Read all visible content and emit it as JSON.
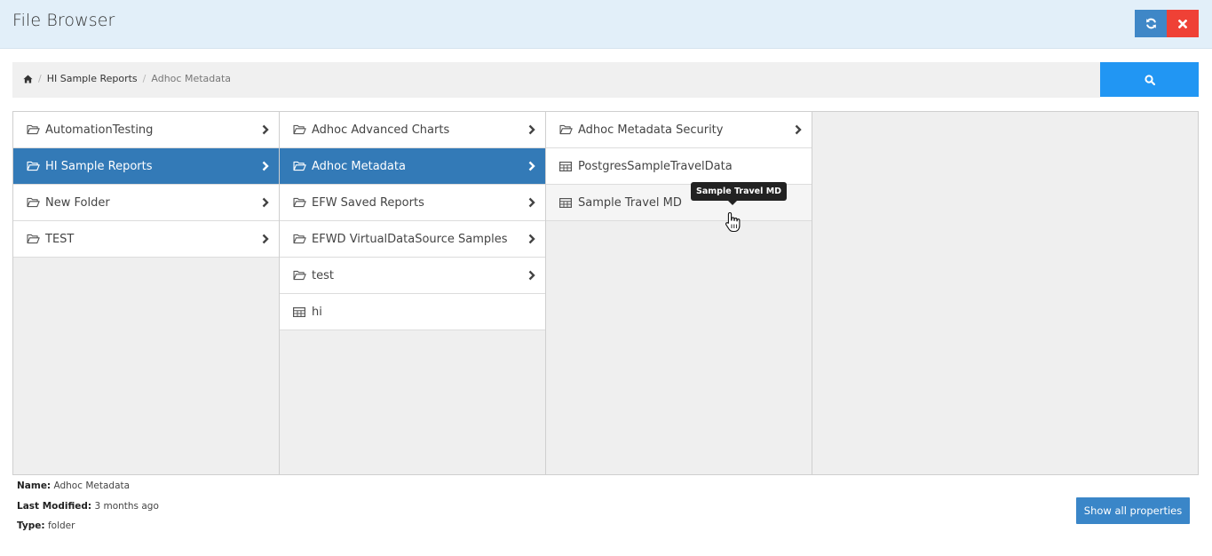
{
  "header": {
    "title": "File Browser",
    "refresh_icon": "refresh-icon",
    "close_icon": "close-icon"
  },
  "breadcrumb": {
    "home_icon": "home-icon",
    "items": [
      "HI Sample Reports",
      "Adhoc Metadata"
    ]
  },
  "search": {
    "icon": "search-icon"
  },
  "columns": [
    {
      "items": [
        {
          "label": "AutomationTesting",
          "type": "folder",
          "has_children": true
        },
        {
          "label": "HI Sample Reports",
          "type": "folder",
          "has_children": true,
          "selected": true
        },
        {
          "label": "New Folder",
          "type": "folder",
          "has_children": true
        },
        {
          "label": "TEST",
          "type": "folder",
          "has_children": true
        }
      ]
    },
    {
      "items": [
        {
          "label": "Adhoc Advanced Charts",
          "type": "folder",
          "has_children": true
        },
        {
          "label": "Adhoc Metadata",
          "type": "folder",
          "has_children": true,
          "selected": true
        },
        {
          "label": "EFW Saved Reports",
          "type": "folder",
          "has_children": true
        },
        {
          "label": "EFWD VirtualDataSource Samples",
          "type": "folder",
          "has_children": true
        },
        {
          "label": "test",
          "type": "folder",
          "has_children": true
        },
        {
          "label": "hi",
          "type": "table",
          "has_children": false
        }
      ]
    },
    {
      "items": [
        {
          "label": "Adhoc Metadata Security",
          "type": "folder",
          "has_children": true
        },
        {
          "label": "PostgresSampleTravelData",
          "type": "table",
          "has_children": false
        },
        {
          "label": "Sample Travel MD",
          "type": "table",
          "has_children": false,
          "hover": true
        }
      ]
    }
  ],
  "tooltip": {
    "text": "Sample Travel MD"
  },
  "properties": {
    "name_label": "Name:",
    "name_value": "Adhoc Metadata",
    "modified_label": "Last Modified:",
    "modified_value": "3 months ago",
    "type_label": "Type:",
    "type_value": "folder"
  },
  "show_all_label": "Show all properties",
  "colors": {
    "header_bg": "#e2eff9",
    "selected": "#337ab7",
    "refresh": "#3f87c7",
    "close": "#ef4136",
    "search": "#2196f3"
  }
}
